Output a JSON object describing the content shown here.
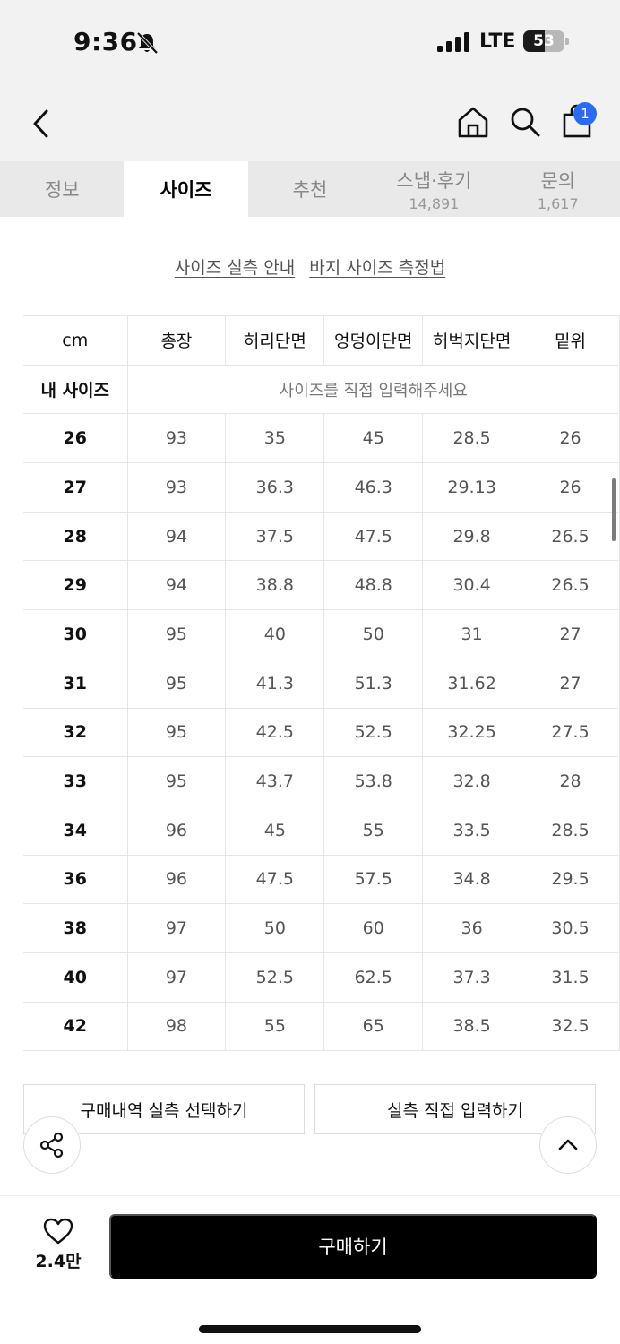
{
  "status_bar": {
    "time": "9:36",
    "network": "LTE",
    "battery": 53
  },
  "header": {
    "cart_count": "1"
  },
  "tabs": [
    {
      "label": "정보",
      "count": ""
    },
    {
      "label": "사이즈",
      "count": ""
    },
    {
      "label": "추천",
      "count": ""
    },
    {
      "label": "스냅·후기",
      "count": "14,891"
    },
    {
      "label": "문의",
      "count": "1,617"
    }
  ],
  "guide": {
    "size_guide": "사이즈 실측 안내",
    "measure_guide": "바지 사이즈 측정법"
  },
  "size_table": {
    "unit": "cm",
    "columns": [
      "총장",
      "허리단면",
      "엉덩이단면",
      "허벅지단면",
      "밑위"
    ],
    "my_size_label": "내 사이즈",
    "my_size_prompt": "사이즈를 직접 입력해주세요",
    "rows": [
      {
        "size": "26",
        "values": [
          "93",
          "35",
          "45",
          "28.5",
          "26"
        ]
      },
      {
        "size": "27",
        "values": [
          "93",
          "36.3",
          "46.3",
          "29.13",
          "26"
        ]
      },
      {
        "size": "28",
        "values": [
          "94",
          "37.5",
          "47.5",
          "29.8",
          "26.5"
        ]
      },
      {
        "size": "29",
        "values": [
          "94",
          "38.8",
          "48.8",
          "30.4",
          "26.5"
        ]
      },
      {
        "size": "30",
        "values": [
          "95",
          "40",
          "50",
          "31",
          "27"
        ]
      },
      {
        "size": "31",
        "values": [
          "95",
          "41.3",
          "51.3",
          "31.62",
          "27"
        ]
      },
      {
        "size": "32",
        "values": [
          "95",
          "42.5",
          "52.5",
          "32.25",
          "27.5"
        ]
      },
      {
        "size": "33",
        "values": [
          "95",
          "43.7",
          "53.8",
          "32.8",
          "28"
        ]
      },
      {
        "size": "34",
        "values": [
          "96",
          "45",
          "55",
          "33.5",
          "28.5"
        ]
      },
      {
        "size": "36",
        "values": [
          "96",
          "47.5",
          "57.5",
          "34.8",
          "29.5"
        ]
      },
      {
        "size": "38",
        "values": [
          "97",
          "50",
          "60",
          "36",
          "30.5"
        ]
      },
      {
        "size": "40",
        "values": [
          "97",
          "52.5",
          "62.5",
          "37.3",
          "31.5"
        ]
      },
      {
        "size": "42",
        "values": [
          "98",
          "55",
          "65",
          "38.5",
          "32.5"
        ]
      }
    ]
  },
  "actions": {
    "select_history": "구매내역 실측 선택하기",
    "manual_input": "실측 직접 입력하기"
  },
  "bottom": {
    "like_count": "2.4만",
    "buy_label": "구매하기"
  },
  "icons": [
    "bell-off-icon",
    "signal-icon",
    "battery-icon",
    "back-icon",
    "home-icon",
    "search-icon",
    "cart-icon",
    "share-icon",
    "chevron-up-icon",
    "heart-icon"
  ],
  "colors": {
    "accent_badge": "#2a6cf0",
    "buy_button": "#000000",
    "header_bg": "#f2f2f2",
    "tab_bg": "#e9e9e9"
  }
}
